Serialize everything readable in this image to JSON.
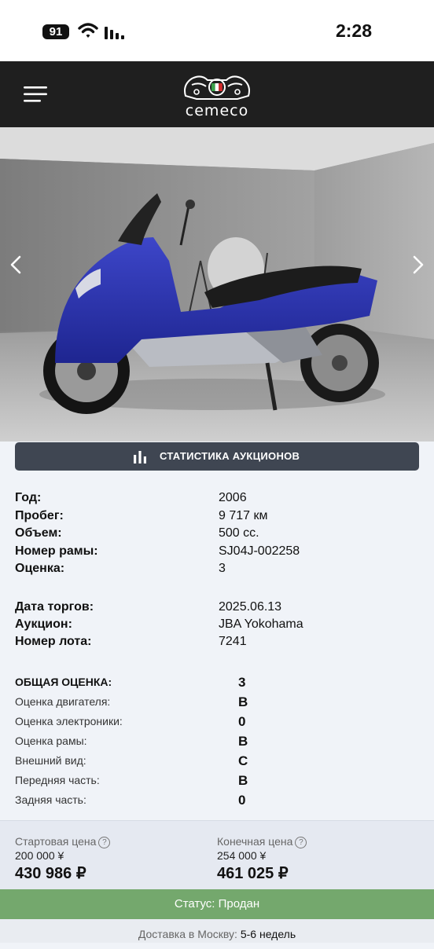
{
  "status_bar": {
    "time": "2:28",
    "battery": "91"
  },
  "header": {
    "logo_text": "cemeco"
  },
  "gallery": {
    "prev_icon": "chevron-left-icon",
    "next_icon": "chevron-right-icon"
  },
  "stats_button": {
    "label": "СТАТИСТИКА АУКЦИОНОВ",
    "icon": "bar-chart-icon"
  },
  "specs": [
    {
      "label": "Год:",
      "value": "2006"
    },
    {
      "label": "Пробег:",
      "value": "9 717 км"
    },
    {
      "label": "Объем:",
      "value": "500 сс."
    },
    {
      "label": "Номер рамы:",
      "value": "SJ04J-002258"
    },
    {
      "label": "Оценка:",
      "value": "3"
    }
  ],
  "auction": [
    {
      "label": "Дата торгов:",
      "value": "2025.06.13"
    },
    {
      "label": "Аукцион:",
      "value": "JBA Yokohama"
    },
    {
      "label": "Номер лота:",
      "value": "7241"
    }
  ],
  "grades": [
    {
      "label": "ОБЩАЯ ОЦЕНКА:",
      "value": "3"
    },
    {
      "label": "Оценка двигателя:",
      "value": "B"
    },
    {
      "label": "Оценка электроники:",
      "value": "0"
    },
    {
      "label": "Оценка рамы:",
      "value": "B"
    },
    {
      "label": "Внешний вид:",
      "value": "C"
    },
    {
      "label": "Передняя часть:",
      "value": "B"
    },
    {
      "label": "Задняя часть:",
      "value": "0"
    }
  ],
  "prices": {
    "start": {
      "label": "Стартовая цена",
      "yen": "200 000 ¥",
      "rub": "430 986 ₽"
    },
    "final": {
      "label": "Конечная цена",
      "yen": "254 000 ¥",
      "rub": "461 025 ₽"
    },
    "help_glyph": "?"
  },
  "status": {
    "text": "Статус: Продан",
    "color": "#74a86d"
  },
  "delivery": {
    "label": "Доставка в Москву:",
    "value": "5-6 недель"
  }
}
